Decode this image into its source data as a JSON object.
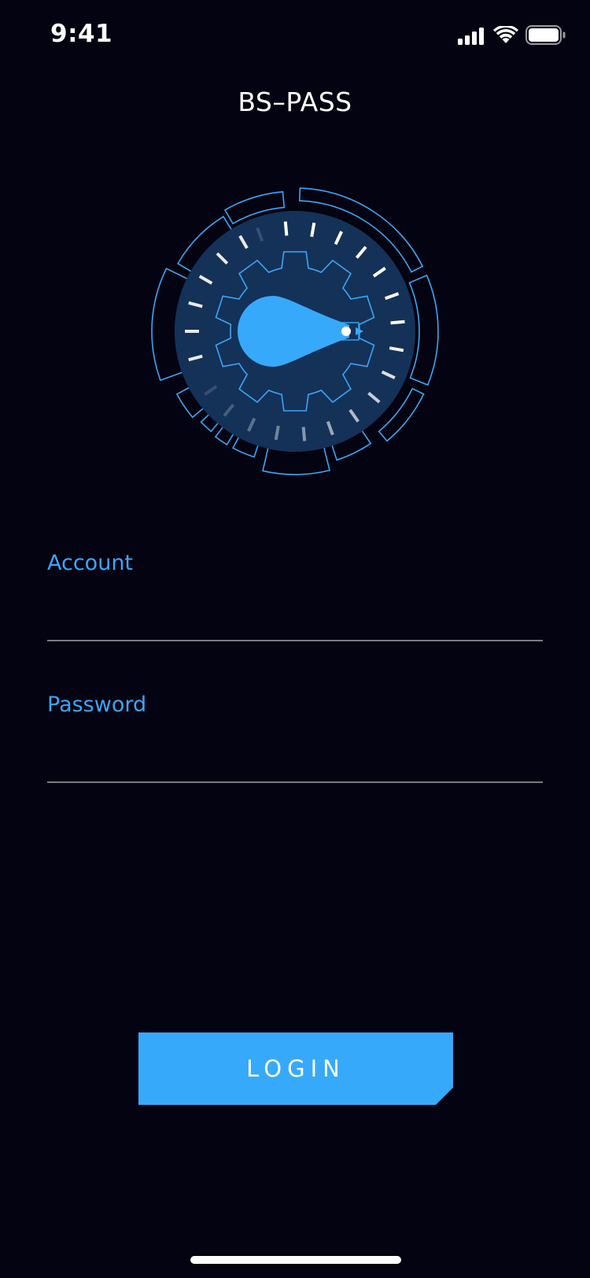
{
  "status_bar": {
    "time": "9:41",
    "icons": [
      "cellular-signal-icon",
      "wifi-icon",
      "battery-icon"
    ]
  },
  "app": {
    "title": "BS–PASS"
  },
  "dial": {
    "icon": "gear-dial-icon",
    "colors": {
      "ring": "#3aa6f9",
      "face": "#143158",
      "needle": "#37a9fb"
    }
  },
  "form": {
    "account": {
      "label": "Account",
      "value": "",
      "placeholder": ""
    },
    "password": {
      "label": "Password",
      "value": "",
      "placeholder": ""
    }
  },
  "login_button": {
    "label": "LOGIN"
  },
  "colors": {
    "background": "#040311",
    "accent": "#37a9fb",
    "label": "#3aa6f9",
    "divider": "#7b7b86"
  }
}
